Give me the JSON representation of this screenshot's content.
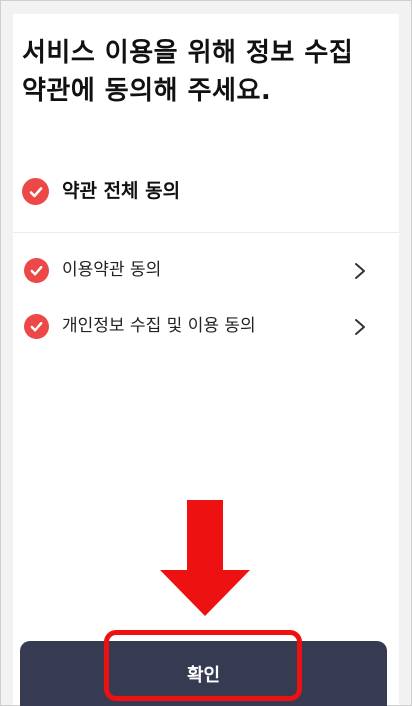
{
  "header": {
    "title_line1": "서비스 이용을 위해 정보 수집",
    "title_line2": "약관에 동의해 주세요."
  },
  "agreements": {
    "all": {
      "label": "약관 전체 동의",
      "checked": true
    },
    "items": [
      {
        "label": "이용약관 동의",
        "checked": true
      },
      {
        "label": "개인정보 수집 및 이용 동의",
        "checked": true
      }
    ]
  },
  "footer": {
    "confirm_label": "확인"
  },
  "colors": {
    "check": "#ec4848",
    "button": "#373b52",
    "annotation": "#ee1111"
  },
  "icons": {
    "check": "check-circle-icon",
    "chevron": "chevron-right-icon",
    "annotation_arrow": "down-arrow-icon"
  }
}
